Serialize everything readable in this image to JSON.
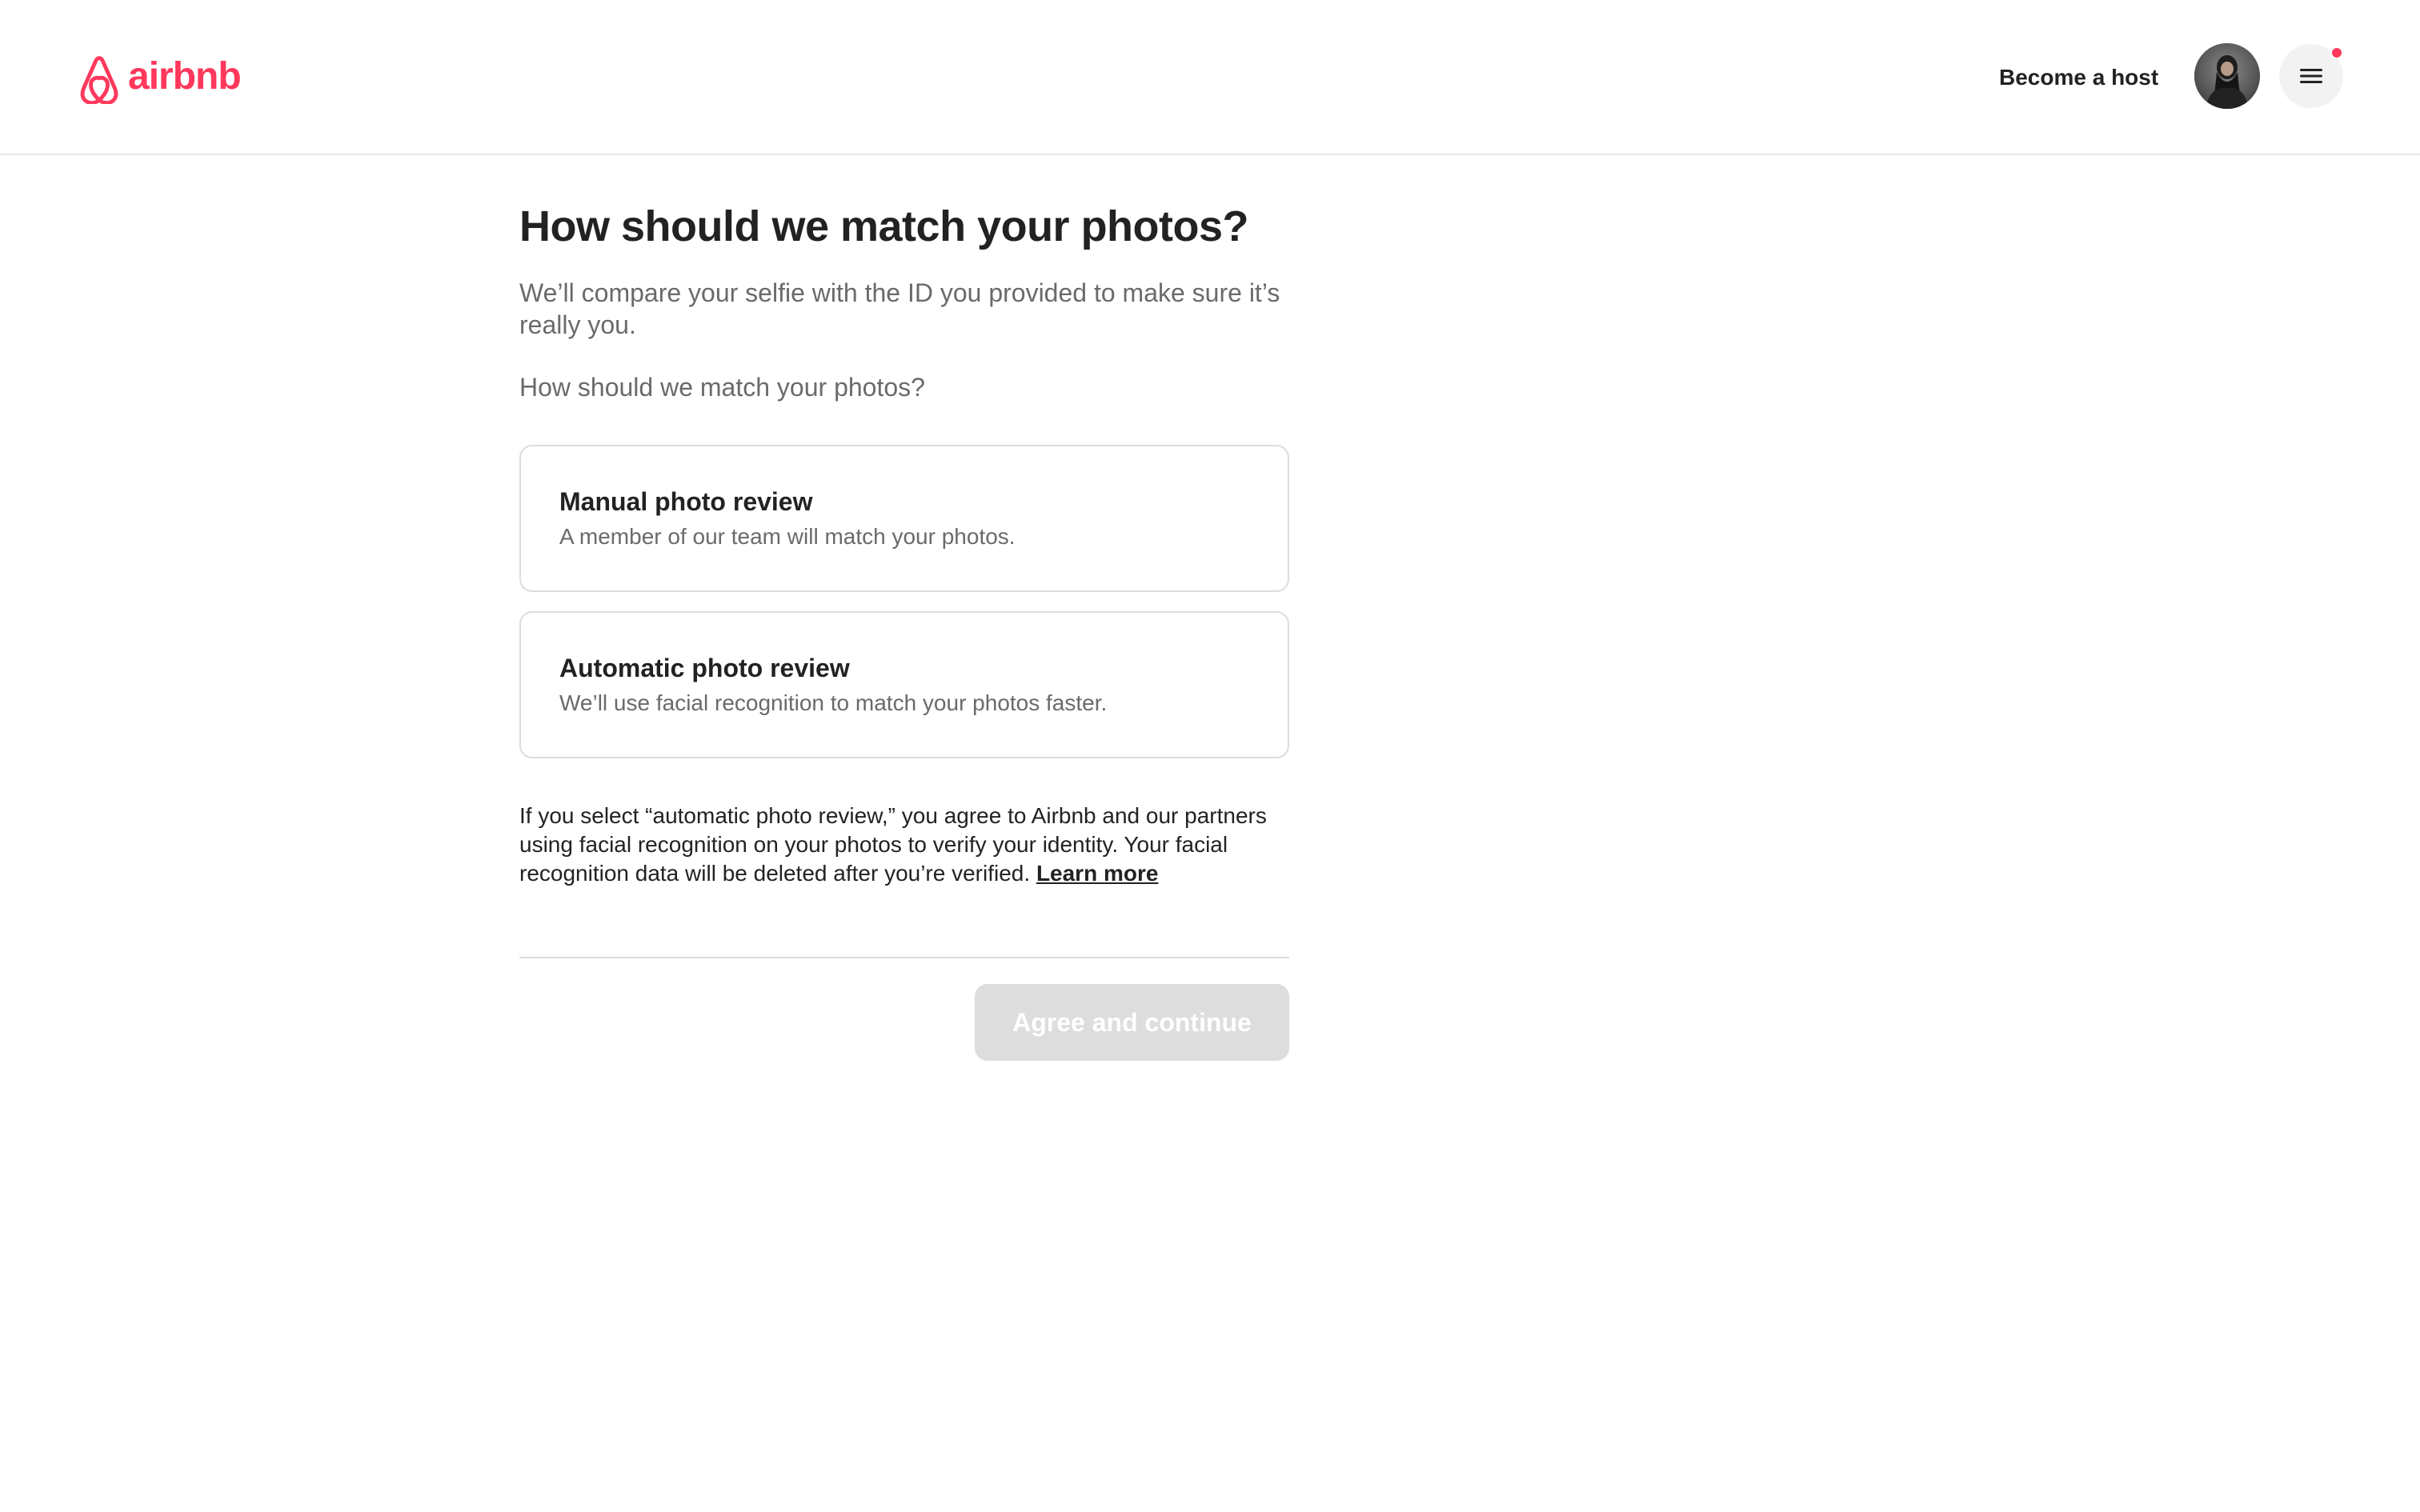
{
  "header": {
    "logo_text": "airbnb",
    "become_host_label": "Become a host",
    "has_notification": true,
    "brand_color": "#FF385C"
  },
  "main": {
    "title": "How should we match your photos?",
    "subtitle": "We’ll compare your selfie with the ID you provided to make sure it’s really you.",
    "question": "How should we match your photos?",
    "options": [
      {
        "title": "Manual photo review",
        "description": "A member of our team will match your photos."
      },
      {
        "title": "Automatic photo review",
        "description": "We’ll use facial recognition to match your photos faster."
      }
    ],
    "disclaimer_text": "If you select “automatic photo review,” you agree to Airbnb and our partners using facial recognition on your photos to verify your identity. Your facial recognition data will be deleted after you’re verified.",
    "learn_more_label": "Learn more",
    "continue_button_label": "Agree and continue",
    "continue_button_disabled": true
  },
  "icons": {
    "logo": "airbnb-belo-icon",
    "menu": "hamburger-menu-icon",
    "avatar": "user-avatar"
  }
}
